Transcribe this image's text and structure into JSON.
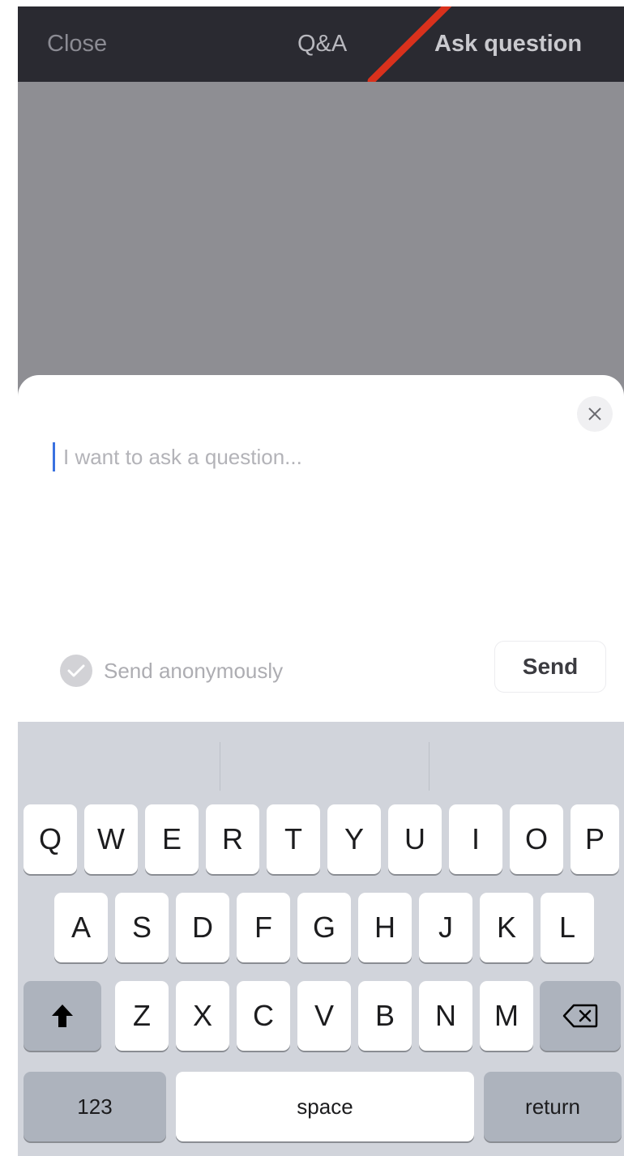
{
  "nav": {
    "close_label": "Close",
    "title": "Q&A",
    "ask_label": "Ask question"
  },
  "sheet": {
    "placeholder": "I want to ask a question...",
    "anonymous_label": "Send anonymously",
    "send_label": "Send"
  },
  "keyboard": {
    "row1": [
      "Q",
      "W",
      "E",
      "R",
      "T",
      "Y",
      "U",
      "I",
      "O",
      "P"
    ],
    "row2": [
      "A",
      "S",
      "D",
      "F",
      "G",
      "H",
      "J",
      "K",
      "L"
    ],
    "row3": [
      "Z",
      "X",
      "C",
      "V",
      "B",
      "N",
      "M"
    ],
    "numbers_label": "123",
    "space_label": "space",
    "return_label": "return"
  },
  "colors": {
    "nav_bg": "#2a2a31",
    "overlay": "#8e8e93",
    "caret": "#3a71e0",
    "annotation_arrow": "#d9311c",
    "keyboard_bg": "#d1d4db"
  },
  "icons": {
    "close": "x-close-icon",
    "anonymous": "checkmark-circle-icon",
    "shift": "shift-arrow-icon",
    "backspace": "backspace-icon"
  }
}
